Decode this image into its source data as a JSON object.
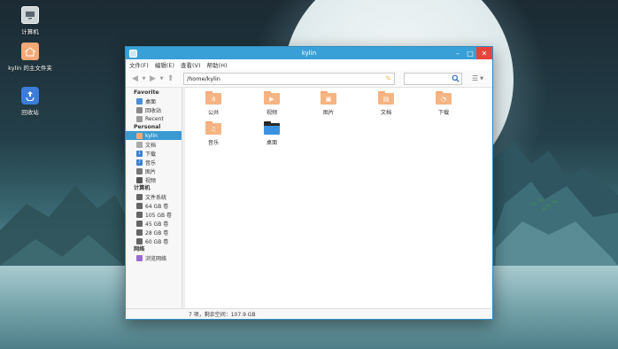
{
  "desktop": {
    "icons": [
      {
        "label": "计算机",
        "icon": "computer-icon"
      },
      {
        "label": "kylin 的主文件夹",
        "icon": "home-folder-icon"
      },
      {
        "label": "回收站",
        "icon": "trash-icon"
      }
    ]
  },
  "window": {
    "title": "kylin",
    "menu": [
      "文件(F)",
      "编辑(E)",
      "查看(V)",
      "帮助(H)"
    ],
    "path": "/home/kylin",
    "search_value": "",
    "sidebar": {
      "favorite": {
        "title": "Favorite",
        "items": [
          "桌面",
          "回收站",
          "Recent"
        ]
      },
      "personal": {
        "title": "Personal",
        "items": [
          "kylin",
          "文档",
          "下载",
          "音乐",
          "图片",
          "视频"
        ]
      },
      "computer": {
        "title": "计算机",
        "items": [
          "文件系统",
          "64 GB 卷",
          "105 GB 卷",
          "45 GB 卷",
          "28 GB 卷",
          "60 GB 卷"
        ]
      },
      "network": {
        "title": "网络",
        "items": [
          "浏览网络"
        ]
      }
    },
    "files": [
      {
        "label": "公共",
        "icon": "share-icon"
      },
      {
        "label": "视频",
        "icon": "video-icon"
      },
      {
        "label": "图片",
        "icon": "picture-icon"
      },
      {
        "label": "文档",
        "icon": "document-icon"
      },
      {
        "label": "下载",
        "icon": "download-icon"
      },
      {
        "label": "音乐",
        "icon": "music-icon"
      },
      {
        "label": "桌面",
        "icon": "desktop-icon"
      }
    ],
    "status": "7 项，剩余空间：107.9 GB"
  },
  "colors": {
    "titlebar": "#38a0d6",
    "selection": "#3a9bd3",
    "folder": "#f6b483",
    "close": "#e6433b"
  }
}
